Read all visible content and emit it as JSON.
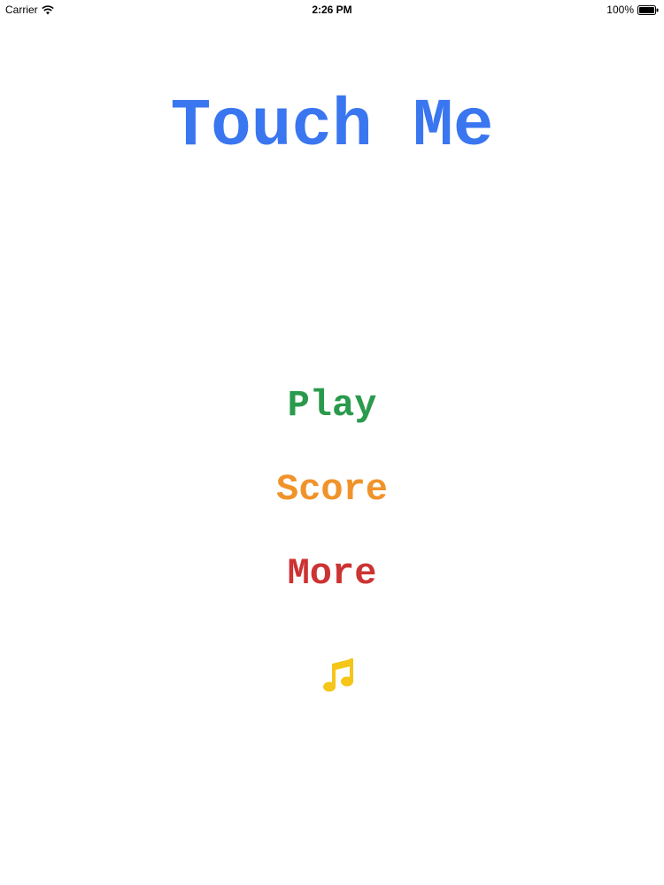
{
  "status_bar": {
    "carrier": "Carrier",
    "time": "2:26 PM",
    "battery": "100%"
  },
  "title": "Touch Me",
  "menu": {
    "play_label": "Play",
    "score_label": "Score",
    "more_label": "More",
    "music_icon": "music-note-icon"
  },
  "colors": {
    "title": "#3a76f0",
    "play": "#2a9a4c",
    "score": "#f0932b",
    "more": "#cc3333",
    "music": "#f5c518"
  }
}
